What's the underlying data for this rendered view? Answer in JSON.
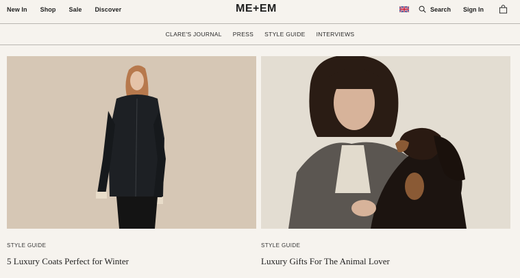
{
  "header": {
    "nav_left": [
      "New In",
      "Shop",
      "Sale",
      "Discover"
    ],
    "logo": "ME+EM",
    "search_label": "Search",
    "signin_label": "Sign In",
    "flag_icon": "uk-flag-icon",
    "bag_icon": "shopping-bag-icon"
  },
  "subnav": {
    "items": [
      "CLARE'S JOURNAL",
      "PRESS",
      "STYLE GUIDE",
      "INTERVIEWS"
    ]
  },
  "articles": [
    {
      "category": "STYLE GUIDE",
      "title": "5 Luxury Coats Perfect for Winter"
    },
    {
      "category": "STYLE GUIDE",
      "title": "Luxury Gifts For The Animal Lover"
    }
  ],
  "colors": {
    "background": "#f6f3ee",
    "text": "#1e1e1e",
    "divider": "#b9b6b1"
  }
}
